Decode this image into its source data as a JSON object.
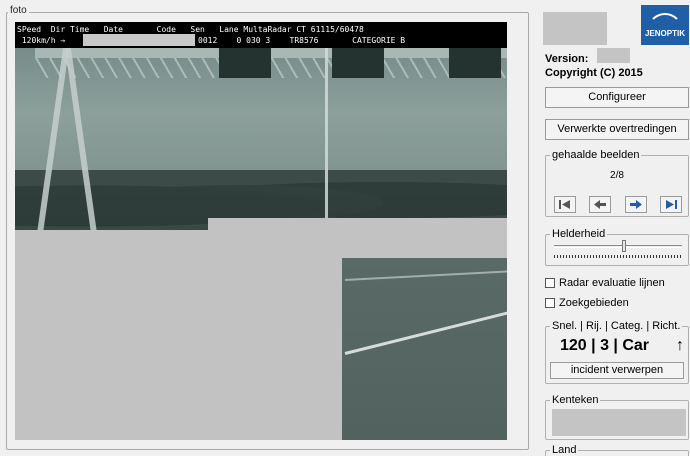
{
  "foto": {
    "legend": "foto",
    "banner": {
      "line1": "SPeed  Dir Time   Date       Code   Sen   Lane MultaRadar CT 61115/60478",
      "line2_left": " 120km/h →",
      "line2_right": "0012    0 030 3    TR8576       CATEGORIE B"
    }
  },
  "side": {
    "logo_text": "JENOPTIK",
    "version_label": "Version:",
    "copyright": "Copyright (C) 2015",
    "configureer_label": "Configureer",
    "verwerkte_label": "Verwerkte overtredingen",
    "beelden": {
      "legend": "gehaalde beelden",
      "counter": "2/8",
      "nav_icons": [
        "first-icon",
        "previous-icon",
        "next-icon",
        "last-icon"
      ]
    },
    "helderheid": {
      "legend": "Helderheid",
      "level": 0.55
    },
    "checkboxes": [
      {
        "label": "Radar evaluatie lijnen",
        "checked": false
      },
      {
        "label": "Zoekgebieden",
        "checked": false
      }
    ],
    "snel": {
      "legend": "Snel. | Rij. | Categ. | Richt.",
      "value": "120 | 3 | Car",
      "arrow": "↑",
      "incident_label": "incident verwerpen"
    },
    "kenteken_legend": "Kenteken",
    "land_legend": "Land"
  },
  "colors": {
    "brand": "#1f5fa8",
    "redaction": "#c4c4c4"
  }
}
